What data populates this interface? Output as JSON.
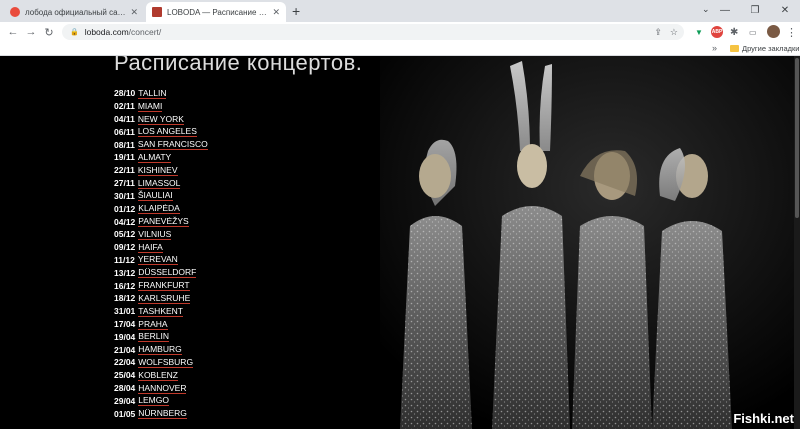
{
  "browser": {
    "tabs": [
      {
        "title": "лобода официальный сайт — Я",
        "active": false,
        "favicon_color": "#e94b3c"
      },
      {
        "title": "LOBODA — Расписание концертов",
        "active": true,
        "favicon_color": "#b03a2e"
      }
    ],
    "new_tab": "+",
    "address": {
      "host": "loboda.com",
      "path": "/concert/"
    },
    "bookmarks": {
      "chevron": "»",
      "other": "Другие закладки"
    }
  },
  "page": {
    "title": "Расписание концертов.",
    "concerts": [
      {
        "date": "28/10",
        "city": "TALLIN"
      },
      {
        "date": "02/11",
        "city": "MIAMI"
      },
      {
        "date": "04/11",
        "city": "NEW YORK"
      },
      {
        "date": "06/11",
        "city": "LOS ANGELES"
      },
      {
        "date": "08/11",
        "city": "SAN FRANCISCO"
      },
      {
        "date": "19/11",
        "city": "ALMATY"
      },
      {
        "date": "22/11",
        "city": "KISHINEV"
      },
      {
        "date": "27/11",
        "city": "LIMASSOL"
      },
      {
        "date": "30/11",
        "city": "ŠIAULIAI"
      },
      {
        "date": "01/12",
        "city": "KLAIPĖDA"
      },
      {
        "date": "04/12",
        "city": "PANEVĖŽYS"
      },
      {
        "date": "05/12",
        "city": "VILNIUS"
      },
      {
        "date": "09/12",
        "city": "HAIFA"
      },
      {
        "date": "11/12",
        "city": "YEREVAN"
      },
      {
        "date": "13/12",
        "city": "DÜSSELDORF"
      },
      {
        "date": "16/12",
        "city": "FRANKFURT"
      },
      {
        "date": "18/12",
        "city": "KARLSRUHE"
      },
      {
        "date": "31/01",
        "city": "TASHKENT"
      },
      {
        "date": "17/04",
        "city": "PRAHA"
      },
      {
        "date": "19/04",
        "city": "BERLIN"
      },
      {
        "date": "21/04",
        "city": "HAMBURG"
      },
      {
        "date": "22/04",
        "city": "WOLFSBURG"
      },
      {
        "date": "25/04",
        "city": "KOBLENZ"
      },
      {
        "date": "28/04",
        "city": "HANNOVER"
      },
      {
        "date": "29/04",
        "city": "LEMGO"
      },
      {
        "date": "01/05",
        "city": "NÜRNBERG"
      }
    ]
  },
  "watermark": "Fishki.net",
  "colors": {
    "accent_underline": "#c0392b",
    "page_bg": "#000000"
  }
}
